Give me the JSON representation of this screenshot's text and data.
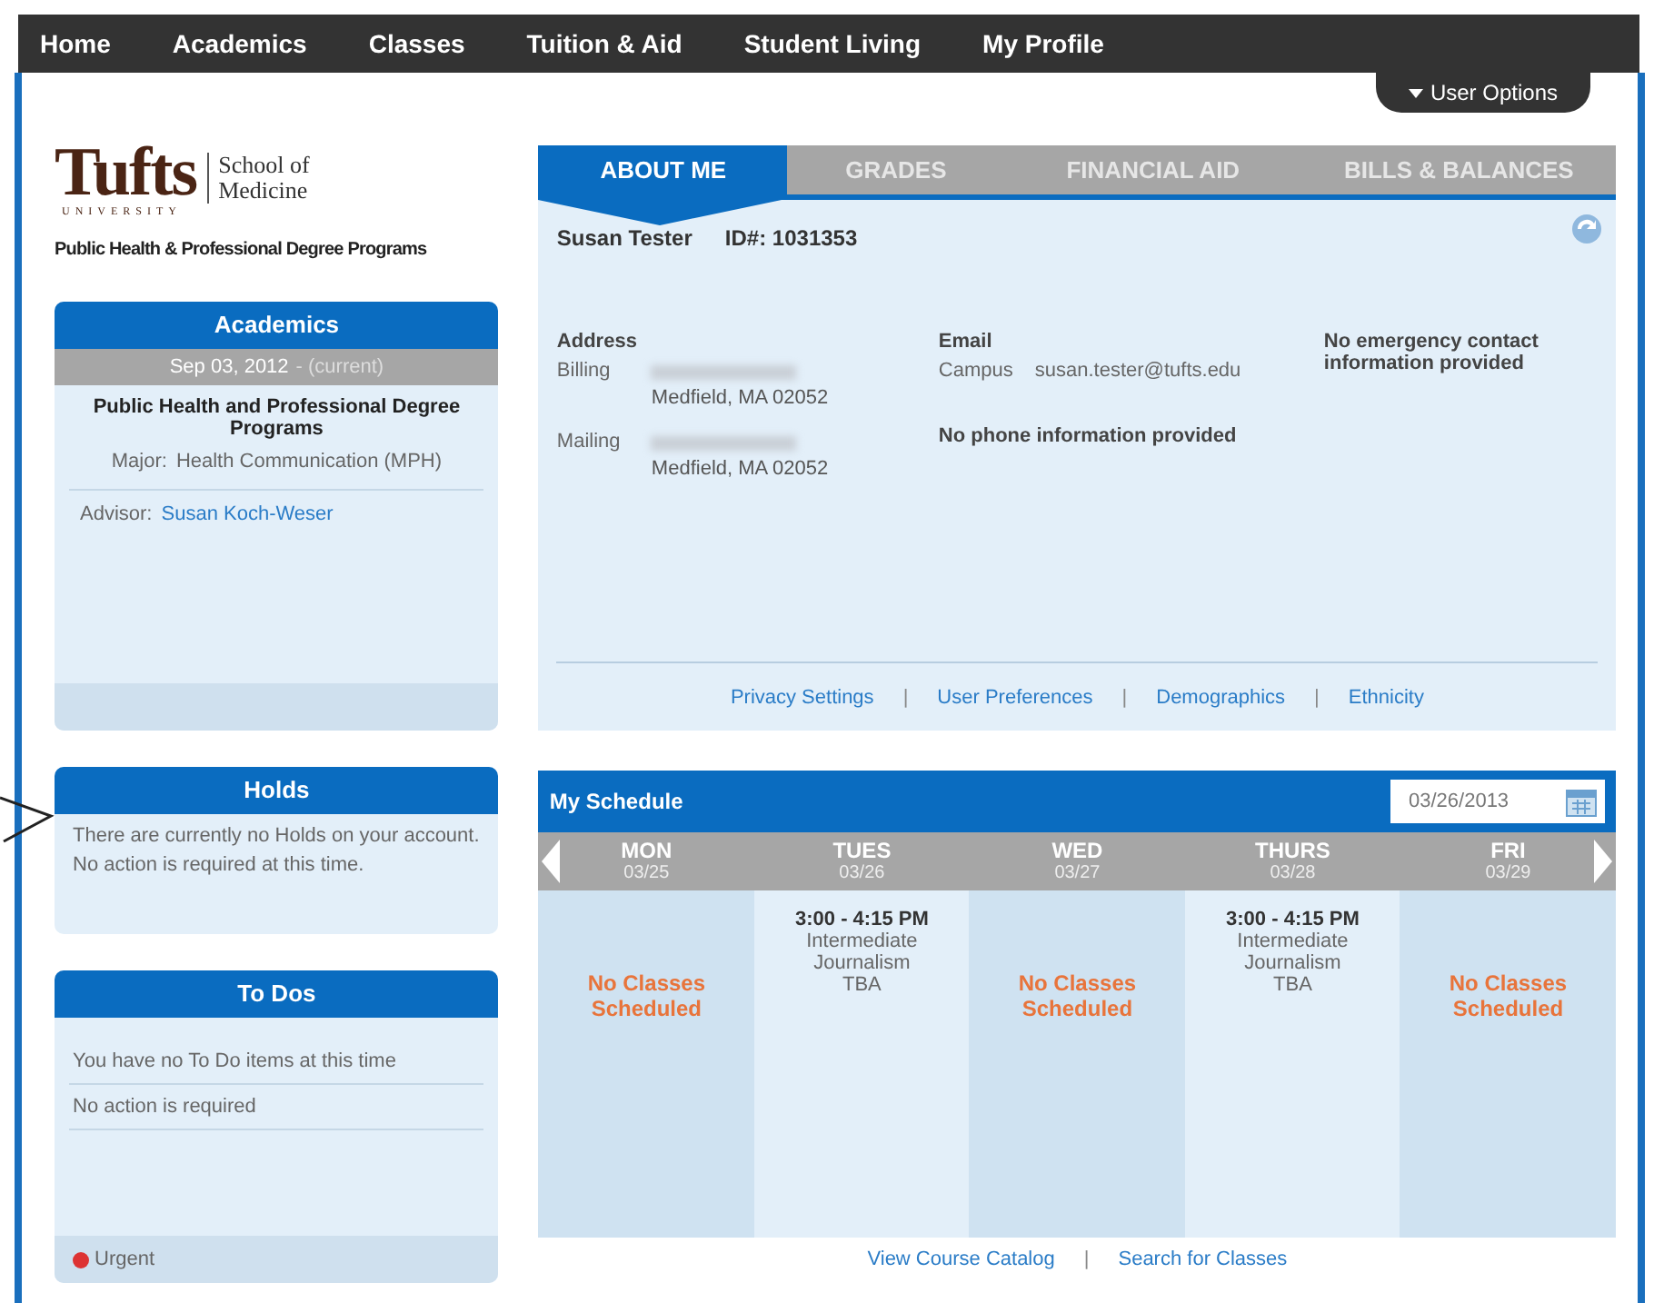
{
  "nav": {
    "items": [
      {
        "label": "Home"
      },
      {
        "label": "Academics"
      },
      {
        "label": "Classes"
      },
      {
        "label": "Tuition & Aid"
      },
      {
        "label": "Student Living"
      },
      {
        "label": "My Profile"
      }
    ],
    "user_options": "User Options"
  },
  "logo": {
    "wordmark": "Tufts",
    "university": "UNIVERSITY",
    "school": "School of Medicine",
    "program": "Public Health & Professional Degree Programs"
  },
  "academics": {
    "title": "Academics",
    "term": "Sep 03, 2012",
    "term_note": "- (current)",
    "program": "Public Health and Professional Degree Programs",
    "major_label": "Major:",
    "major": "Health Communication (MPH)",
    "advisor_label": "Advisor:",
    "advisor": "Susan Koch-Weser"
  },
  "holds": {
    "title": "Holds",
    "lines": [
      "There are currently no Holds on your account.",
      "No action is required at this time."
    ]
  },
  "todos": {
    "title": "To Dos",
    "lines": [
      "You have no To Do items at this time",
      "No action is required"
    ],
    "legend": "Urgent"
  },
  "tabs": [
    {
      "label": "ABOUT ME",
      "selected": true
    },
    {
      "label": "GRADES",
      "selected": false
    },
    {
      "label": "FINANCIAL AID",
      "selected": false
    },
    {
      "label": "BILLS & BALANCES",
      "selected": false
    }
  ],
  "about": {
    "name": "Susan Tester",
    "id_label": "ID#:",
    "id": "1031353",
    "address_title": "Address",
    "addresses": [
      {
        "label": "Billing",
        "city": "Medfield, MA 02052"
      },
      {
        "label": "Mailing",
        "city": "Medfield, MA 02052"
      }
    ],
    "email_title": "Email",
    "email_label": "Campus",
    "email": "susan.tester@tufts.edu",
    "phone_note": "No phone information provided",
    "emergency_note": "No emergency contact information provided",
    "links": [
      "Privacy Settings",
      "User Preferences",
      "Demographics",
      "Ethnicity"
    ],
    "separators": [
      "|",
      "|",
      "|"
    ]
  },
  "schedule": {
    "title": "My Schedule",
    "date": "03/26/2013",
    "days": [
      {
        "day": "MON",
        "date": "03/25",
        "kind": "empty",
        "text": "No Classes Scheduled"
      },
      {
        "day": "TUES",
        "date": "03/26",
        "kind": "class",
        "time": "3:00 - 4:15 PM",
        "course": "Intermediate Journalism",
        "room": "TBA"
      },
      {
        "day": "WED",
        "date": "03/27",
        "kind": "empty",
        "text": "No Classes Scheduled"
      },
      {
        "day": "THURS",
        "date": "03/28",
        "kind": "class",
        "time": "3:00 - 4:15 PM",
        "course": "Intermediate Journalism",
        "room": "TBA"
      },
      {
        "day": "FRI",
        "date": "03/29",
        "kind": "empty",
        "text": "No Classes Scheduled"
      }
    ],
    "links": [
      "View Course Catalog",
      "Search for Classes"
    ],
    "separators": [
      "|"
    ]
  }
}
